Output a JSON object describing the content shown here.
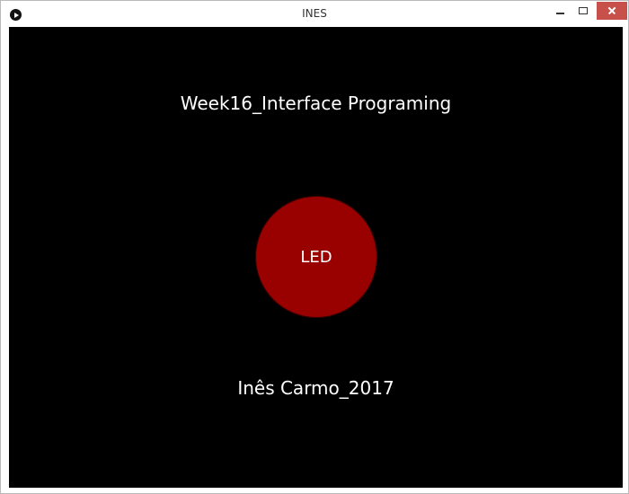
{
  "window": {
    "title": "INES"
  },
  "canvas": {
    "heading": "Week16_Interface Programing",
    "led_button_label": "LED",
    "footer": "Inês Carmo_2017"
  },
  "colors": {
    "canvas_background": "#000000",
    "led_button": "#990000",
    "text": "#ffffff",
    "close_button": "#c7504a"
  },
  "icons": {
    "app": "play-icon",
    "minimize": "minimize-icon",
    "maximize": "maximize-icon",
    "close": "close-icon"
  }
}
